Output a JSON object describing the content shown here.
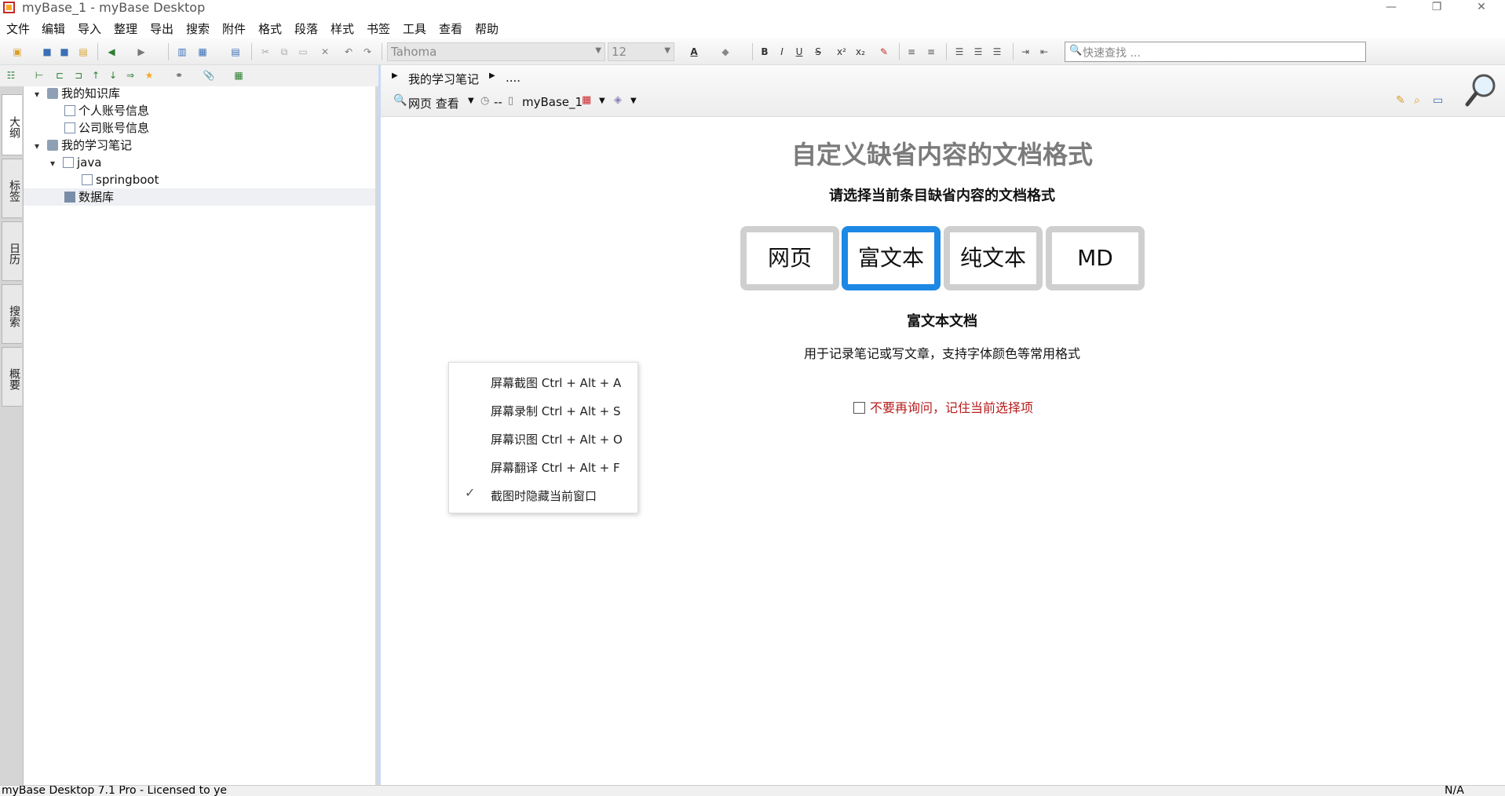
{
  "window": {
    "title": "myBase_1 - myBase Desktop",
    "controls": [
      "—",
      "❐",
      "✕"
    ]
  },
  "menu": [
    "文件",
    "编辑",
    "导入",
    "整理",
    "导出",
    "搜索",
    "附件",
    "格式",
    "段落",
    "样式",
    "书签",
    "工具",
    "查看",
    "帮助"
  ],
  "toolbar": {
    "font_name": "Tahoma",
    "font_size": "12",
    "search_placeholder": "快速查找 ..."
  },
  "sidebar": {
    "tabs": [
      "大纲",
      "标签",
      "日历",
      "搜索",
      "概要"
    ]
  },
  "tree": [
    {
      "label": "我的知识库",
      "level": 0,
      "type": "book",
      "expanded": true
    },
    {
      "label": "个人账号信息",
      "level": 1,
      "type": "doc"
    },
    {
      "label": "公司账号信息",
      "level": 1,
      "type": "doc"
    },
    {
      "label": "我的学习笔记",
      "level": 0,
      "type": "book",
      "expanded": true
    },
    {
      "label": "java",
      "level": 1,
      "type": "doc",
      "expanded": true
    },
    {
      "label": "springboot",
      "level": 2,
      "type": "doc"
    },
    {
      "label": "数据库",
      "level": 1,
      "type": "doc",
      "selected": true
    }
  ],
  "breadcrumb": {
    "path1": "我的学习笔记",
    "path2": "....",
    "view_label": "网页 查看",
    "separator": "--",
    "db_name": "myBase_1"
  },
  "content": {
    "title": "自定义缺省内容的文档格式",
    "subtitle": "请选择当前条目缺省内容的文档格式",
    "formats": [
      "网页",
      "富文本",
      "纯文本",
      "MD"
    ],
    "selected_format": "富文本",
    "format_heading": "富文本文档",
    "format_desc": "用于记录笔记或写文章，支持字体颜色等常用格式",
    "remember_label": "不要再询问，记住当前选择项"
  },
  "context_menu": {
    "items": [
      "屏幕截图 Ctrl + Alt + A",
      "屏幕录制 Ctrl + Alt + S",
      "屏幕识图 Ctrl + Alt + O",
      "屏幕翻译 Ctrl + Alt + F",
      "截图时隐藏当前窗口"
    ],
    "checked_index": 4
  },
  "status": {
    "left": "myBase Desktop 7.1 Pro - Licensed to ye",
    "right": "N/A"
  }
}
